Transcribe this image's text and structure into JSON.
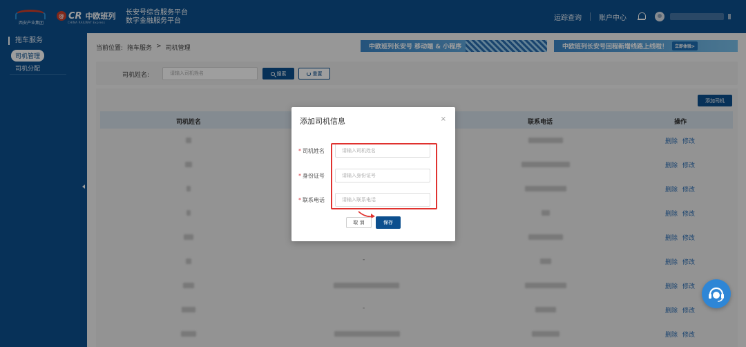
{
  "header": {
    "logo1_text": "西安产业集团",
    "logo2_badge": "@",
    "logo2_cr": "CR",
    "logo2_zhongou": "中欧班列",
    "logo2_sub": "CHINA RAILWAY Express",
    "platform_line1": "长安号综合服务平台",
    "platform_line2": "数字金融服务平台",
    "nav_waybill": "运踪查询",
    "nav_account": "账户中心"
  },
  "sidebar": {
    "group": "拖车服务",
    "items": [
      {
        "label": "司机管理",
        "active": true
      },
      {
        "label": "司机分配",
        "active": false
      }
    ]
  },
  "breadcrumb": {
    "prefix": "当前位置:",
    "level1": "拖车服务",
    "sep": ">",
    "level2": "司机管理"
  },
  "banners": {
    "banner1": "中欧班列长安号 移动端 & 小程序",
    "banner2": "中欧班列长安号回程新增线路上线啦！",
    "banner2_tail": "立即体验>"
  },
  "search": {
    "label": "司机姓名:",
    "placeholder": "请输入司机姓名",
    "search_btn": "搜索",
    "reset_btn": "重置"
  },
  "table": {
    "add_btn": "添加司机",
    "headers": [
      "司机姓名",
      "联系电话",
      "操作"
    ],
    "actions": {
      "delete": "删除",
      "edit": "修改"
    },
    "dash": "-"
  },
  "modal": {
    "title": "添加司机信息",
    "close": "×",
    "fields": [
      {
        "label": "司机姓名",
        "placeholder": "请输入司机姓名"
      },
      {
        "label": "身份证号",
        "placeholder": "请输入身份证号"
      },
      {
        "label": "联系电话",
        "placeholder": "请输入联系电话"
      }
    ],
    "required_mark": "*",
    "cancel_btn": "取 消",
    "save_btn": "保存"
  },
  "colors": {
    "brand": "#0c4f8e",
    "highlight": "#e0322f",
    "link": "#2d6fb5"
  },
  "icons": [
    "bell-icon",
    "avatar",
    "search-icon",
    "refresh-icon",
    "close-icon",
    "support-icon",
    "chevron-left-icon"
  ]
}
